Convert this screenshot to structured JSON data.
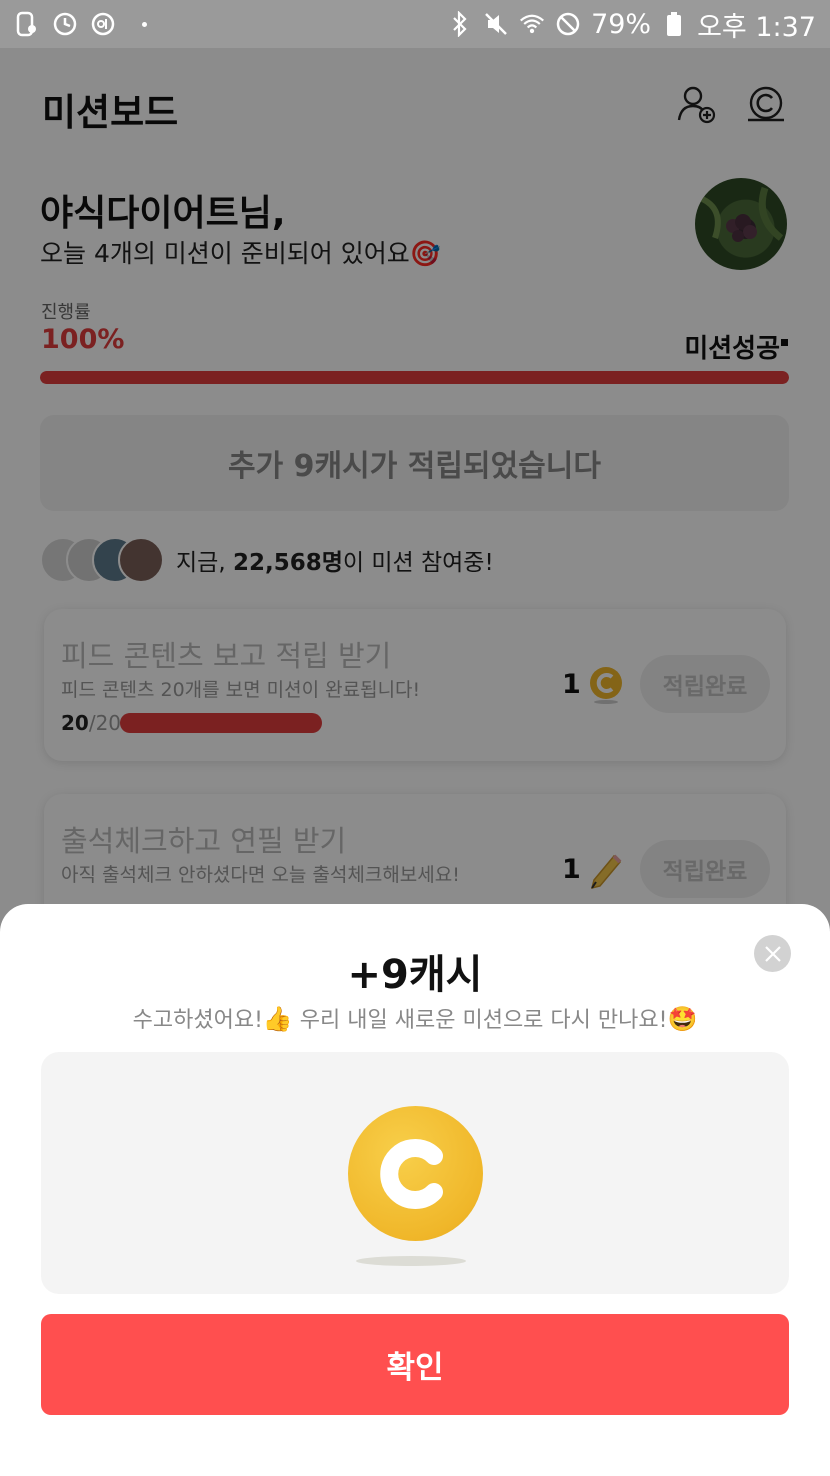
{
  "status_bar": {
    "battery": "79%",
    "time": "오후 1:37"
  },
  "header": {
    "title": "미션보드",
    "icons": [
      "add-friend-icon",
      "cash-icon"
    ]
  },
  "greeting": {
    "name": "야식다이어트님,",
    "subtitle": "오늘 4개의 미션이 준비되어 있어요🎯"
  },
  "progress": {
    "label": "진행률",
    "value": "100%",
    "fraction": 1.0,
    "status": "미션성공",
    "accent_color": "#e03c3c"
  },
  "banner": {
    "text": "추가 9캐시가 적립되었습니다"
  },
  "participants": {
    "prefix": "지금, ",
    "count": "22,568명",
    "suffix": "이 미션 참여중!"
  },
  "missions": [
    {
      "title": "피드 콘텐츠 보고 적립 받기",
      "description": "피드 콘텐츠 20개를 보면 미션이 완료됩니다!",
      "progress_done": "20",
      "progress_total": "/20",
      "progress_fraction": 1.0,
      "reward": "1",
      "reward_icon": "coin-icon",
      "button": "적립완료"
    },
    {
      "title": "출석체크하고 연필 받기",
      "description": "아직 출석체크 안하셨다면 오늘 출석체크해보세요!",
      "reward": "1",
      "reward_icon": "pencil-icon",
      "button": "적립완료"
    }
  ],
  "modal": {
    "title": "+9캐시",
    "subtitle_part1": "수고하셨어요!",
    "subtitle_emoji1": "👍",
    "subtitle_part2": " 우리 내일 새로운 미션으로 다시 만나요!",
    "subtitle_emoji2": "🤩",
    "icon": "coin-icon",
    "confirm_label": "확인",
    "confirm_color": "#ff4f4f"
  }
}
